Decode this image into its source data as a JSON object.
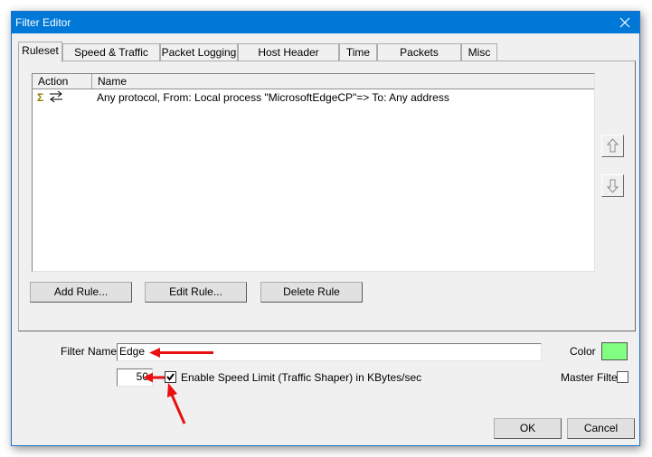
{
  "window": {
    "title": "Filter Editor",
    "close_icon": "close-icon"
  },
  "tabs": [
    {
      "label": "Ruleset",
      "active": true
    },
    {
      "label": "Speed & Traffic Limit",
      "active": false
    },
    {
      "label": "Packet Logging",
      "active": false
    },
    {
      "label": "Host Header Logging",
      "active": false
    },
    {
      "label": "Time",
      "active": false
    },
    {
      "label": "Packets rewriting",
      "active": false
    },
    {
      "label": "Misc",
      "active": false
    }
  ],
  "ruleset": {
    "columns": [
      "Action",
      "Name"
    ],
    "rows": [
      {
        "action_icons": [
          "sum-icon",
          "bidirectional-arrows-icon"
        ],
        "name": "Any protocol, From: Local process \"MicrosoftEdgeCP\"=> To: Any address"
      }
    ],
    "buttons": {
      "add": "Add Rule...",
      "edit": "Edit Rule...",
      "delete": "Delete Rule"
    },
    "move_up_icon": "arrow-up-icon",
    "move_down_icon": "arrow-down-icon"
  },
  "filter": {
    "name_label": "Filter Name",
    "name_value": "Edge",
    "color_label": "Color",
    "color_value": "#80ff80",
    "speed_limit_value": "50",
    "speed_limit_checked": true,
    "speed_limit_label": "Enable Speed Limit (Traffic Shaper) in KBytes/sec",
    "master_filter_label": "Master Filter",
    "master_filter_checked": false
  },
  "annotations": {
    "color": "#e81010"
  },
  "footer": {
    "ok": "OK",
    "cancel": "Cancel"
  }
}
